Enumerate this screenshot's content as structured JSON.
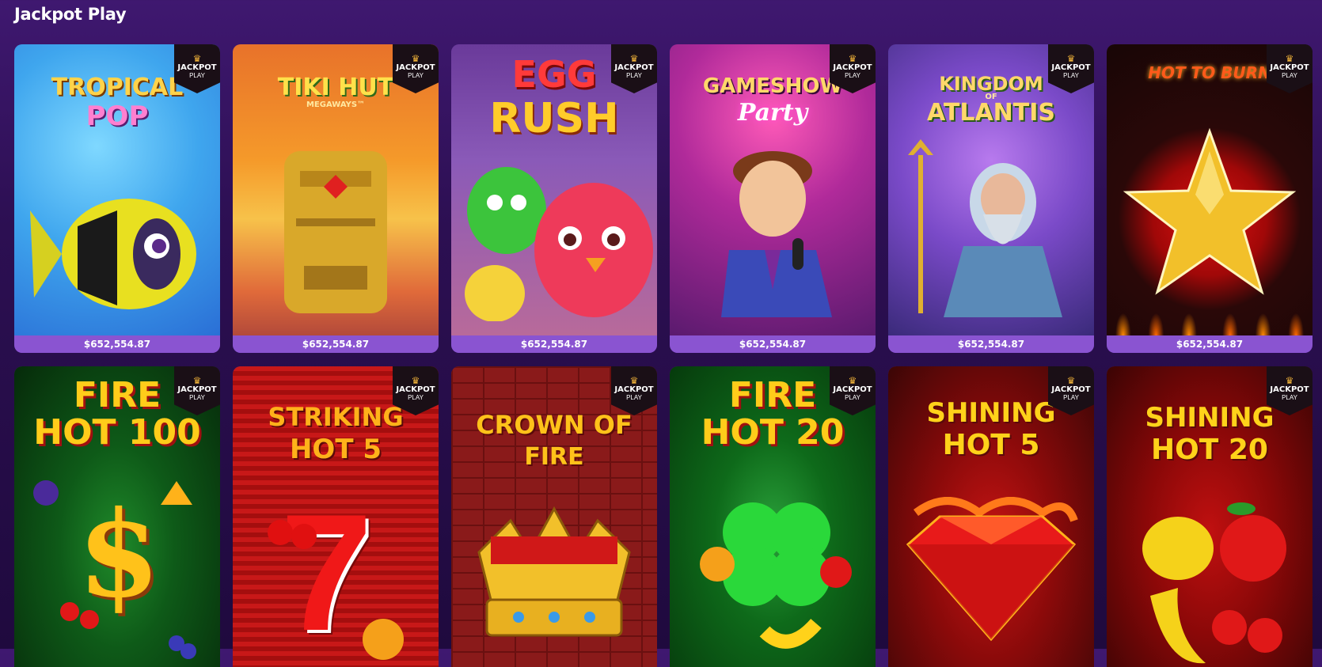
{
  "section": {
    "title": "Jackpot Play"
  },
  "badge": {
    "line1": "JACKPOT",
    "line2": "PLAY",
    "crown": "♛"
  },
  "games": [
    {
      "title": "TROPICAL POP",
      "line1": "TROPICAL",
      "line2": "POP",
      "sub": "",
      "jackpot": "$652,554.87"
    },
    {
      "title": "TIKI HUT MEGAWAYS",
      "line1": "TIKI HUT",
      "line2": "",
      "sub": "MEGAWAYS™",
      "jackpot": "$652,554.87"
    },
    {
      "title": "EGG RUSH",
      "line1": "EGG",
      "line2": "RUSH",
      "sub": "",
      "jackpot": "$652,554.87"
    },
    {
      "title": "GAMESHOW Party",
      "line1": "GAMESHOW",
      "line2": "Party",
      "sub": "",
      "jackpot": "$652,554.87"
    },
    {
      "title": "KINGDOM OF ATLANTIS",
      "line1": "KINGDOM",
      "line2": "ATLANTIS",
      "sub": "OF",
      "jackpot": "$652,554.87"
    },
    {
      "title": "HOT TO BURN",
      "line1": "HOT TO BURN",
      "line2": "",
      "sub": "",
      "jackpot": "$652,554.87"
    },
    {
      "title": "FIRE HOT 100",
      "line1": "FIRE",
      "line2": "HOT 100",
      "sub": ""
    },
    {
      "title": "STRIKING HOT 5",
      "line1": "STRIKING",
      "line2": "HOT 5",
      "sub": "™"
    },
    {
      "title": "CROWN OF FIRE",
      "line1": "CROWN OF",
      "line2": "FIRE",
      "sub": "™"
    },
    {
      "title": "FIRE HOT 20",
      "line1": "FIRE",
      "line2": "HOT 20",
      "sub": ""
    },
    {
      "title": "SHINING HOT 5",
      "line1": "SHINING",
      "line2": "HOT 5",
      "sub": "™"
    },
    {
      "title": "SHINING HOT 20",
      "line1": "SHINING",
      "line2": "HOT 20",
      "sub": "™"
    }
  ]
}
